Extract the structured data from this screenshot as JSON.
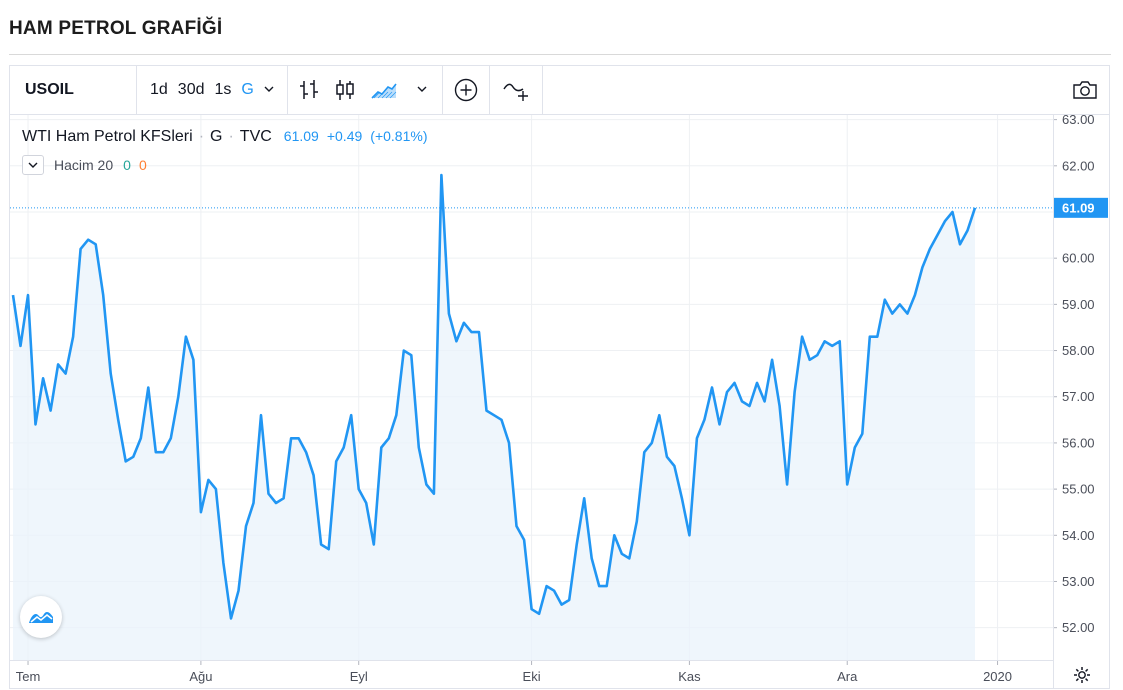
{
  "page": {
    "title": "HAM PETROL GRAFİĞİ"
  },
  "toolbar": {
    "symbol": "USOIL",
    "intervals": [
      "1d",
      "30d",
      "1s",
      "G"
    ],
    "active_interval": "G"
  },
  "legend": {
    "symbol_name": "WTI Ham Petrol KFSleri",
    "interval": "G",
    "exchange": "TVC",
    "price": "61.09",
    "change": "+0.49",
    "change_pct": "(+0.81%)",
    "volume_label": "Hacim 20",
    "volume_a": "0",
    "volume_b": "0"
  },
  "colors": {
    "line": "#2196f3",
    "area": "#eaf3fb",
    "grid": "#eef0f3",
    "axis_text": "#4a4e59",
    "price_badge": "#2196f3",
    "volume_up": "#26a69a",
    "volume_down": "#ff7f32"
  },
  "icons": [
    "chevron-down-icon",
    "bar-chart-icon",
    "candlestick-icon",
    "area-chart-icon",
    "add-indicator-icon",
    "compare-icon",
    "camera-icon",
    "gear-icon",
    "tradingview-logo-icon"
  ],
  "chart_data": {
    "type": "line",
    "y_ticks": [
      52,
      53,
      54,
      55,
      56,
      57,
      58,
      59,
      60,
      61,
      62,
      63
    ],
    "y_tick_labels": [
      "52.00",
      "53.00",
      "54.00",
      "55.00",
      "56.00",
      "57.00",
      "58.00",
      "59.00",
      "60.00",
      "61.00",
      "62.00",
      "63.00"
    ],
    "ylim": [
      51.3,
      63.1
    ],
    "x_labels": [
      "Tem",
      "Ağu",
      "Eyl",
      "Eki",
      "Kas",
      "Ara",
      "2020"
    ],
    "x_label_index": [
      2,
      25,
      46,
      69,
      90,
      111,
      131
    ],
    "last_price_label": "61.09",
    "series": [
      {
        "values": [
          59.2,
          58.1,
          59.2,
          56.4,
          57.4,
          56.7,
          57.7,
          57.5,
          58.3,
          60.2,
          60.4,
          60.3,
          59.2,
          57.5,
          56.5,
          55.6,
          55.7,
          56.1,
          57.2,
          55.8,
          55.8,
          56.1,
          57.0,
          58.3,
          57.8,
          54.5,
          55.2,
          55.0,
          53.4,
          52.2,
          52.8,
          54.2,
          54.7,
          56.6,
          54.9,
          54.7,
          54.8,
          56.1,
          56.1,
          55.8,
          55.3,
          53.8,
          53.7,
          55.6,
          55.9,
          56.6,
          55.0,
          54.7,
          53.8,
          55.9,
          56.1,
          56.6,
          58.0,
          57.9,
          55.9,
          55.1,
          54.9,
          61.8,
          58.8,
          58.2,
          58.6,
          58.4,
          58.4,
          56.7,
          56.6,
          56.5,
          56.0,
          54.2,
          53.9,
          52.4,
          52.3,
          52.9,
          52.8,
          52.5,
          52.6,
          53.8,
          54.8,
          53.5,
          52.9,
          52.9,
          54.0,
          53.6,
          53.5,
          54.3,
          55.8,
          56.0,
          56.6,
          55.7,
          55.5,
          54.8,
          54.0,
          56.1,
          56.5,
          57.2,
          56.4,
          57.1,
          57.3,
          56.9,
          56.8,
          57.3,
          56.9,
          57.8,
          56.8,
          55.1,
          57.1,
          58.3,
          57.8,
          57.9,
          58.2,
          58.1,
          58.2,
          55.1,
          55.9,
          56.2,
          58.3,
          58.3,
          59.1,
          58.8,
          59.0,
          58.8,
          59.2,
          59.8,
          60.2,
          60.5,
          60.8,
          61.0,
          60.3,
          60.6,
          61.09
        ]
      }
    ]
  }
}
